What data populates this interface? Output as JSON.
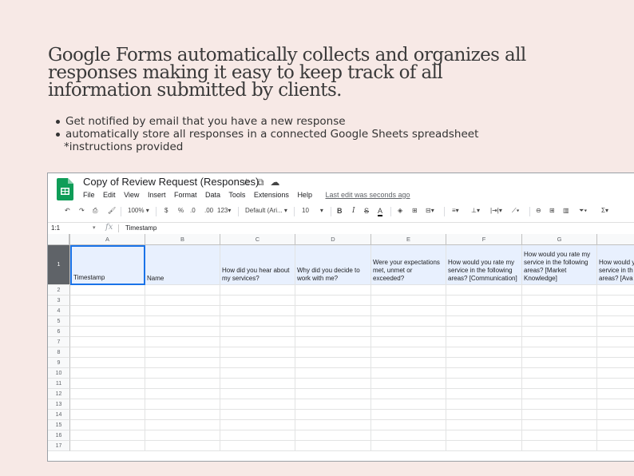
{
  "headline": "Google Forms automatically collects and organizes all responses making it easy to keep track of all information submitted by clients.",
  "bullets": [
    "Get notified by email that you have a new response",
    "automatically store all responses in a connected Google Sheets spreadsheet"
  ],
  "note": "*instructions provided",
  "sheet": {
    "title": "Copy of Review Request (Responses)",
    "menu": [
      "File",
      "Edit",
      "View",
      "Insert",
      "Format",
      "Data",
      "Tools",
      "Extensions",
      "Help"
    ],
    "last_edit": "Last edit was seconds ago",
    "icons": {
      "star": "star-icon",
      "move": "folder-move-icon",
      "cloud": "cloud-status-icon"
    },
    "toolbar": {
      "zoom": "100%",
      "currency": "$",
      "percent": "%",
      "dec_decrease": ".0",
      "dec_increase": ".00",
      "more_formats": "123",
      "font": "Default (Ari...",
      "font_size": "10",
      "bold": "B",
      "italic": "I",
      "strike": "S",
      "text_color": "A"
    },
    "name_box": "1:1",
    "formula_value": "Timestamp",
    "columns": [
      "A",
      "B",
      "C",
      "D",
      "E",
      "F",
      "G",
      ""
    ],
    "header_row": [
      "Timestamp",
      "Name",
      "How did you hear about my services?",
      "Why did you decide to work with me?",
      "Were your expectations met, unmet or exceeded?",
      "How would you rate my service in the following areas? [Communication]",
      "How would you rate my service in the following areas? [Market Knowledge]",
      "How would y\nservice in th\nareas? [Ava"
    ],
    "row_numbers": [
      "1",
      "2",
      "3",
      "4",
      "5",
      "6",
      "7",
      "8",
      "9",
      "10",
      "11",
      "12",
      "13",
      "14",
      "15",
      "16",
      "17"
    ],
    "colors": {
      "accent": "#1a73e8",
      "header_fill": "#e8f0fe",
      "sheets_green": "#0f9d58"
    }
  }
}
